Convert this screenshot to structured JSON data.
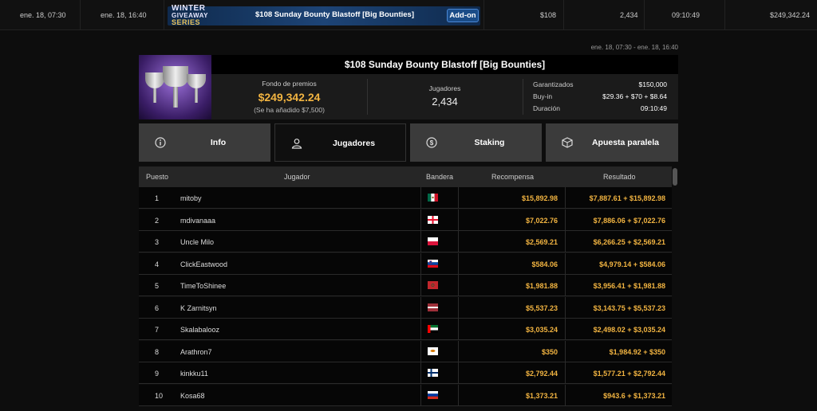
{
  "top_row": {
    "start": "ene. 18, 07:30",
    "end": "ene. 18, 16:40",
    "series_logo": [
      "WINTER",
      "GIVEAWAY",
      "SERIES"
    ],
    "event": "$108 Sunday Bounty Blastoff [Big Bounties]",
    "addon_label": "Add-on",
    "buyin": "$108",
    "entries": "2,434",
    "duration": "09:10:49",
    "prize": "$249,342.24"
  },
  "date_range": "ene. 18, 07:30 - ene. 18, 16:40",
  "tournament": {
    "title": "$108 Sunday Bounty Blastoff [Big Bounties]",
    "prize_label": "Fondo de premios",
    "prize_value": "$249,342.24",
    "prize_note": "(Se ha añadido $7,500)",
    "players_label": "Jugadores",
    "players_value": "2,434",
    "details": [
      {
        "key": "Garantizados",
        "value": "$150,000"
      },
      {
        "key": "Buy-in",
        "value": "$29.36 + $70 + $8.64"
      },
      {
        "key": "Duración",
        "value": "09:10:49"
      }
    ]
  },
  "tabs": [
    {
      "label": "Info",
      "icon": "info-icon"
    },
    {
      "label": "Jugadores",
      "icon": "user-icon"
    },
    {
      "label": "Staking",
      "icon": "dollar-coin-icon"
    },
    {
      "label": "Apuesta paralela",
      "icon": "dice-icon"
    }
  ],
  "table": {
    "headers": {
      "pos": "Puesto",
      "player": "Jugador",
      "flag": "Bandera",
      "reward": "Recompensa",
      "result": "Resultado"
    },
    "rows": [
      {
        "pos": "1",
        "name": "mitoby",
        "flag": "Mexico",
        "reward": "$15,892.98",
        "result": "$7,887.61 + $15,892.98"
      },
      {
        "pos": "2",
        "name": "mdivanaaa",
        "flag": "Georgia",
        "reward": "$7,022.76",
        "result": "$7,886.06 + $7,022.76"
      },
      {
        "pos": "3",
        "name": "Uncle Milo",
        "flag": "Poland",
        "reward": "$2,569.21",
        "result": "$6,266.25 + $2,569.21"
      },
      {
        "pos": "4",
        "name": "ClickEastwood",
        "flag": "Slovenia",
        "reward": "$584.06",
        "result": "$4,979.14 + $584.06"
      },
      {
        "pos": "5",
        "name": "TimeToShinee",
        "flag": "Morocco",
        "reward": "$1,981.88",
        "result": "$3,956.41 + $1,981.88"
      },
      {
        "pos": "6",
        "name": "K Zarnitsyn",
        "flag": "Latvia",
        "reward": "$5,537.23",
        "result": "$3,143.75 + $5,537.23"
      },
      {
        "pos": "7",
        "name": "Skalabalooz",
        "flag": "United Arab Emirates",
        "reward": "$3,035.24",
        "result": "$2,498.02 + $3,035.24"
      },
      {
        "pos": "8",
        "name": "Arathron7",
        "flag": "Cyprus",
        "reward": "$350",
        "result": "$1,984.92 + $350"
      },
      {
        "pos": "9",
        "name": "kinkku11",
        "flag": "Finland",
        "reward": "$2,792.44",
        "result": "$1,577.21 + $2,792.44"
      },
      {
        "pos": "10",
        "name": "Kosa68",
        "flag": "Russia",
        "reward": "$1,373.21",
        "result": "$943.6 + $1,373.21"
      }
    ]
  }
}
